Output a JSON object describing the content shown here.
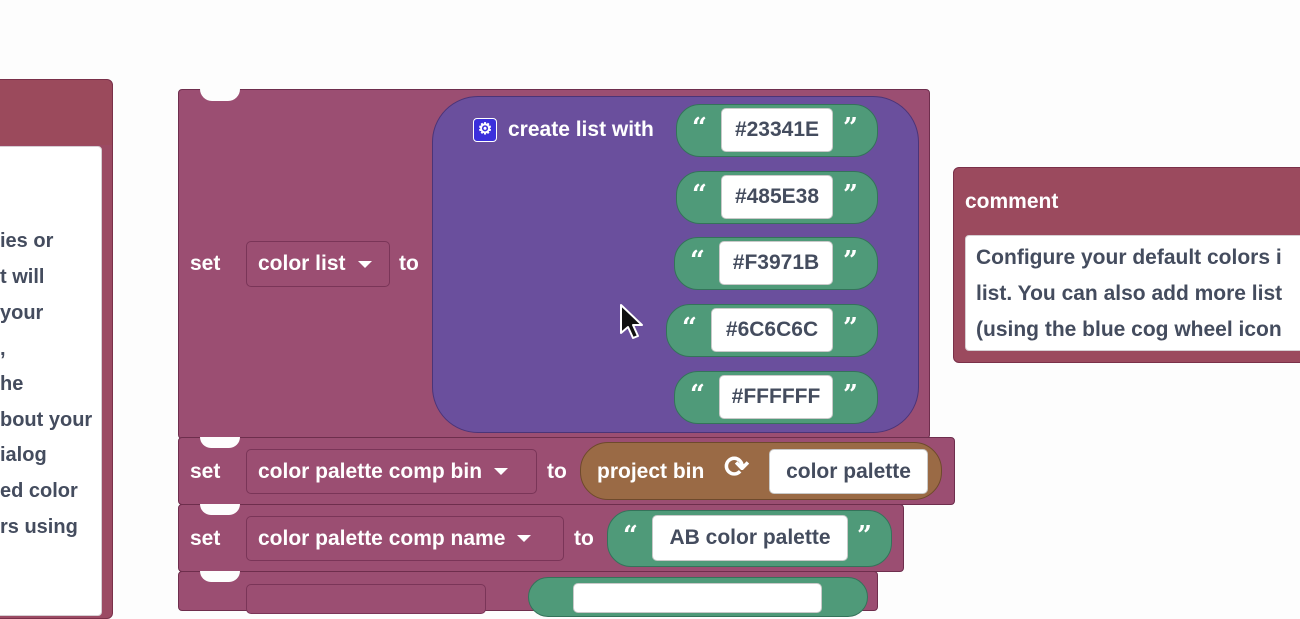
{
  "left_comment": {
    "lines": [
      "ies or",
      "t will",
      "your",
      ",",
      "he",
      "bout your",
      "ialog",
      "ed color",
      "rs using"
    ]
  },
  "blocks": {
    "set_word": "set",
    "to_word": "to",
    "color_list": {
      "variable": "color list",
      "list_label": "create list with",
      "colors": [
        "#23341E",
        "#485E38",
        "#F3971B",
        "#6C6C6C",
        "#FFFFFF"
      ]
    },
    "comp_bin": {
      "variable": "color palette comp bin",
      "bin_label": "project bin",
      "bin_value": "color palette"
    },
    "comp_name": {
      "variable": "color palette comp name",
      "value": "AB color palette"
    }
  },
  "comment": {
    "title": "comment",
    "lines": [
      "Configure your default colors i",
      "list. You can also add more list",
      "(using the blue cog wheel icon"
    ]
  },
  "icons": {
    "cog": "⚙",
    "quote_open": "“",
    "quote_close": "”",
    "refresh": "⟳"
  },
  "colors": {
    "variable_block": "#9b4e72",
    "list_block": "#6a4f9d",
    "text_block": "#4f9a79",
    "bin_block": "#9a6a45",
    "comment_block": "#9b4a5e"
  }
}
